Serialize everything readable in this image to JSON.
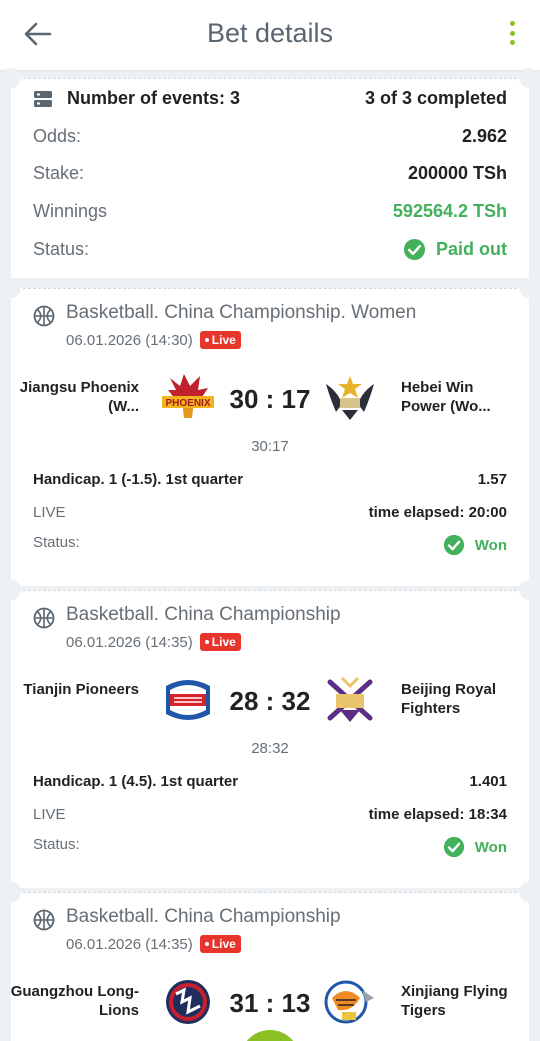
{
  "header": {
    "title": "Bet details"
  },
  "summary": {
    "events_label": "Number of events: 3",
    "completed": "3 of 3 completed",
    "odds_label": "Odds:",
    "odds_value": "2.962",
    "stake_label": "Stake:",
    "stake_value": "200000 TSh",
    "winnings_label": "Winnings",
    "winnings_value": "592564.2 TSh",
    "status_label": "Status:",
    "status_value": "Paid out"
  },
  "events": [
    {
      "title": "Basketball. China Championship. Women",
      "date": "06.01.2026 (14:30)",
      "live": "Live",
      "team1": "Jiangsu Phoenix (W...",
      "team2": "Hebei Win Power (Wo...",
      "score": "30 : 17",
      "subscore": "30:17",
      "market": "Handicap. 1 (-1.5). 1st quarter",
      "coef": "1.57",
      "state": "LIVE",
      "elapsed": "time elapsed: 20:00",
      "status_label": "Status:",
      "result": "Won"
    },
    {
      "title": "Basketball. China Championship",
      "date": "06.01.2026 (14:35)",
      "live": "Live",
      "team1": "Tianjin Pioneers",
      "team2": "Beijing Royal Fighters",
      "score": "28 : 32",
      "subscore": "28:32",
      "market": "Handicap. 1 (4.5). 1st quarter",
      "coef": "1.401",
      "state": "LIVE",
      "elapsed": "time elapsed: 18:34",
      "status_label": "Status:",
      "result": "Won"
    },
    {
      "title": "Basketball. China Championship",
      "date": "06.01.2026 (14:35)",
      "live": "Live",
      "team1": "Guangzhou Long-Lions",
      "team2": "Xinjiang Flying Tigers",
      "score": "31 : 13"
    }
  ],
  "logos": {
    "event1_left_text": "PHOENIX"
  },
  "colors": {
    "accent": "#8bc124",
    "success": "#43b05c",
    "live": "#e8352b"
  }
}
